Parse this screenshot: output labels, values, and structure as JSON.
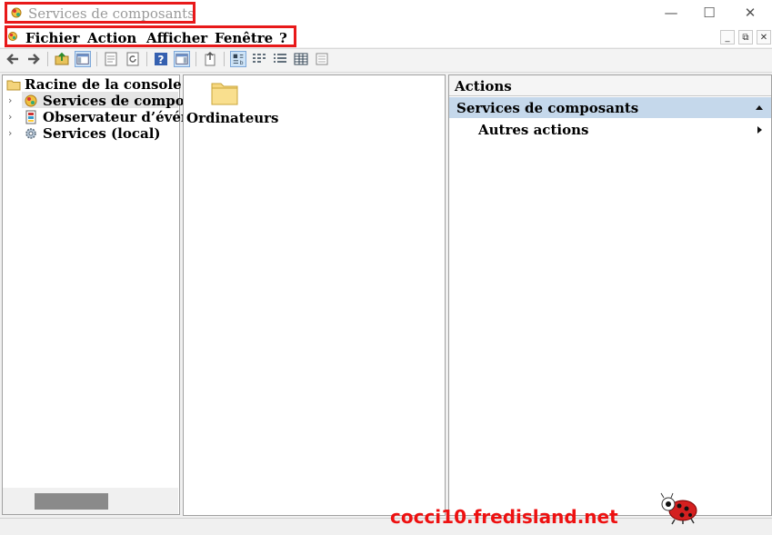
{
  "window": {
    "title": "Services de composants",
    "controls": {
      "minimize": "—",
      "maximize": "☐",
      "close": "✕"
    }
  },
  "menu": {
    "items": [
      "Fichier",
      "Action",
      "Afficher",
      "Fenêtre",
      "?"
    ],
    "mdi_controls": {
      "minimize": "_",
      "restore": "⧉",
      "close": "✕"
    }
  },
  "toolbar": {
    "buttons": [
      "back-icon",
      "forward-icon",
      "up-folder-icon",
      "show-hide-tree-icon",
      "properties-icon",
      "refresh-icon",
      "help-icon",
      "show-hide-action-icon",
      "export-icon",
      "large-icons-view-icon",
      "small-icons-view-icon",
      "list-view-icon",
      "detail-view-icon",
      "properties-sheet-icon"
    ]
  },
  "tree": {
    "root": "Racine de la console",
    "items": [
      {
        "label": "Services de composa",
        "icon": "component-services-icon",
        "selected": true
      },
      {
        "label": "Observateur d’événe",
        "icon": "event-viewer-icon",
        "selected": false
      },
      {
        "label": "Services (local)",
        "icon": "services-gear-icon",
        "selected": false
      }
    ]
  },
  "center": {
    "items": [
      {
        "label": "Ordinateurs",
        "icon": "folder-icon"
      }
    ]
  },
  "actions": {
    "header": "Actions",
    "section_title": "Services de composants",
    "items": [
      {
        "label": "Autres actions"
      }
    ]
  },
  "watermark": "cocci10.fredisland.net",
  "colors": {
    "highlight_box": "#e8191a",
    "action_section_bg": "#c5d8eb",
    "watermark": "#ee1111"
  }
}
